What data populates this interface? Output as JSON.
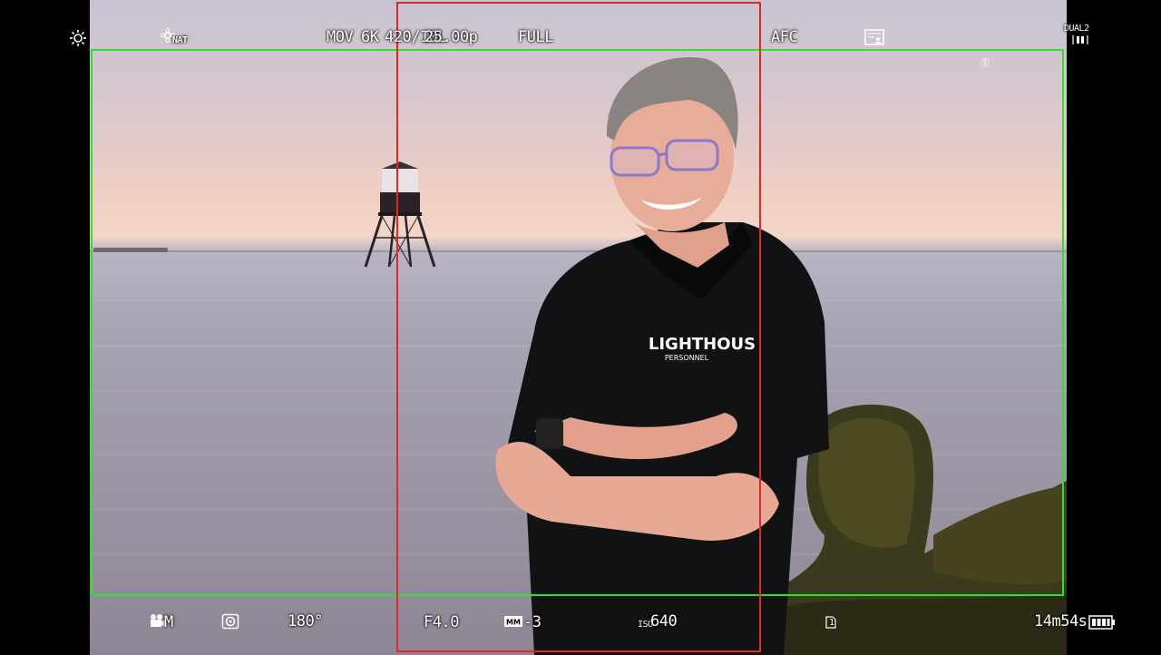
{
  "top_bar": {
    "photo_style": "NAT",
    "rec_format": "MOV",
    "resolution": "6K",
    "codec": "420/10L",
    "frame_rate": "25.00p",
    "image_area": "FULL",
    "focus_mode": "AFC",
    "card_mode": "DUAL2"
  },
  "bottom_bar": {
    "exposure_mode": "M",
    "shutter_angle": "180°",
    "aperture": "F4.0",
    "exposure_comp": "-3",
    "iso_label": "ISO",
    "iso_value": "640",
    "slot": "1",
    "rec_time_remaining": "14m54s"
  },
  "scene_text": {
    "shirt_logo": "LIGHTHOUS",
    "shirt_logo_sub": "PERSONNEL"
  },
  "guide_colors": {
    "frame_guide": "#2fe02f",
    "crop_guide": "#e02828"
  },
  "icons": [
    "brightness-icon",
    "photo-style-icon",
    "card-mode-icon",
    "bluetooth-icon",
    "dual-slot-icon",
    "movie-mode-icon",
    "metering-icon",
    "exposure-comp-icon",
    "battery-icon",
    "card-slot-icon"
  ]
}
